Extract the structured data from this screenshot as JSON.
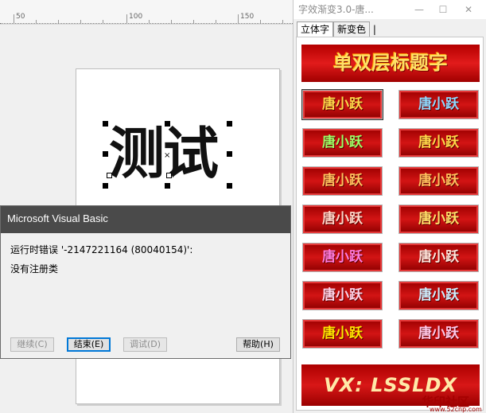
{
  "ruler": {
    "labels": [
      "50",
      "100",
      "150"
    ]
  },
  "canvas": {
    "text": "测试"
  },
  "dialog": {
    "title": "Microsoft Visual Basic",
    "message": "运行时错误 '-2147221164 (80040154)':",
    "detail": "没有注册类",
    "buttons": {
      "continue": "继续(C)",
      "end": "结束(E)",
      "debug": "调试(D)",
      "help": "帮助(H)"
    }
  },
  "panel": {
    "title": "字效渐变3.0-唐...",
    "window_buttons": {
      "minimize": "—",
      "maximize": "☐",
      "close": "✕"
    },
    "tabs": [
      "立体字",
      "新变色"
    ],
    "banner": "单双层标题字",
    "styles": [
      {
        "label": "唐小跃",
        "color": "#ffd84a"
      },
      {
        "label": "唐小跃",
        "color": "#8fd9ff"
      },
      {
        "label": "唐小跃",
        "color": "#9cff66"
      },
      {
        "label": "唐小跃",
        "color": "#ffd84a"
      },
      {
        "label": "唐小跃",
        "color": "#ffc15e"
      },
      {
        "label": "唐小跃",
        "color": "#ffc15e"
      },
      {
        "label": "唐小跃",
        "color": "#ffd6c8"
      },
      {
        "label": "唐小跃",
        "color": "#ffe06a"
      },
      {
        "label": "唐小跃",
        "color": "#ff7ce0"
      },
      {
        "label": "唐小跃",
        "color": "#ffe6dc"
      },
      {
        "label": "唐小跃",
        "color": "#ffd3e8"
      },
      {
        "label": "唐小跃",
        "color": "#cfefff"
      },
      {
        "label": "唐小跃",
        "color": "#ffe600"
      },
      {
        "label": "唐小跃",
        "color": "#ffc8e8"
      }
    ],
    "vx_banner": "VX: LSSLDX"
  },
  "watermark": {
    "text": "华印社区",
    "url": "www.52cnp.com"
  }
}
